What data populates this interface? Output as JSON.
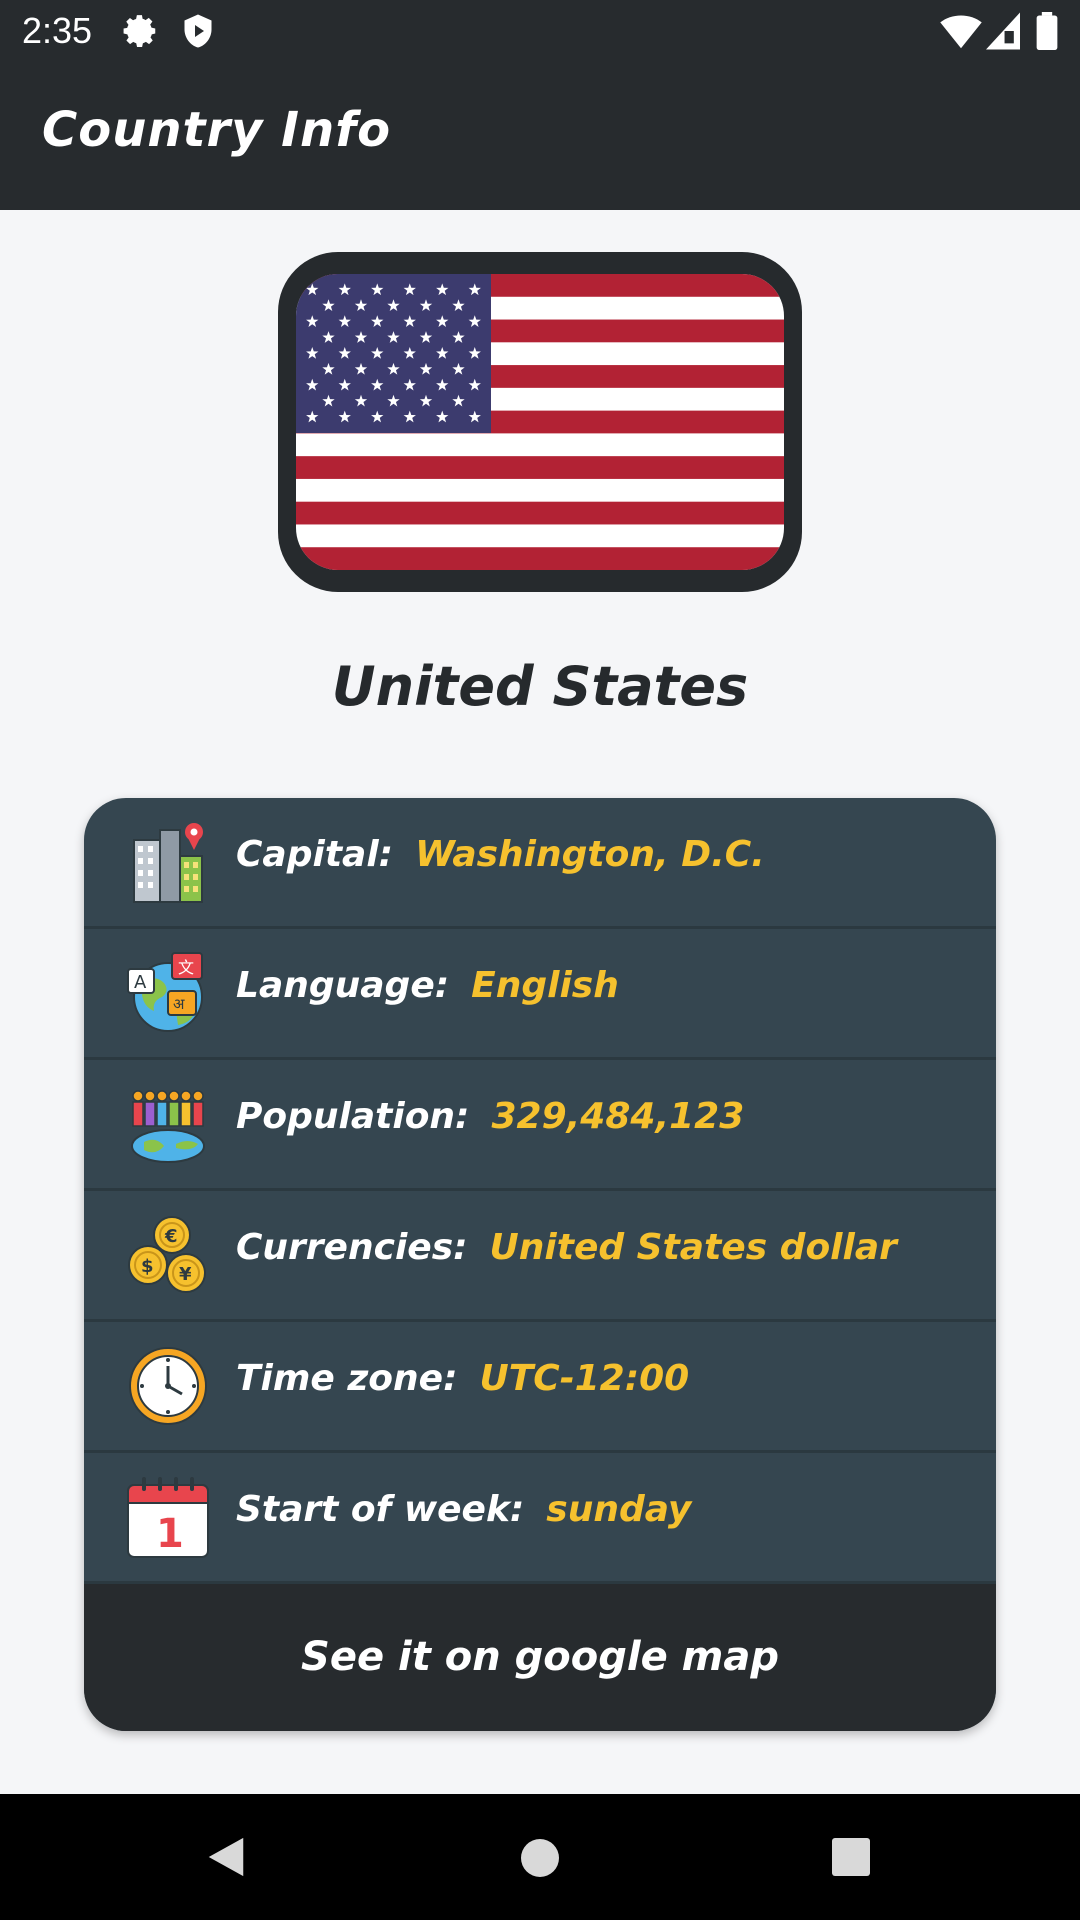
{
  "status_bar": {
    "time": "2:35",
    "icons": [
      "gear-icon",
      "shield-icon",
      "wifi-icon",
      "signal-icon",
      "battery-icon"
    ]
  },
  "app_bar": {
    "title": "Country Info"
  },
  "country": {
    "name": "United States",
    "flag": "us-flag"
  },
  "info": {
    "rows": [
      {
        "icon": "city-building-icon",
        "label": "Capital:",
        "value": "Washington, D.C."
      },
      {
        "icon": "language-globe-icon",
        "label": "Language:",
        "value": "English"
      },
      {
        "icon": "population-globe-icon",
        "label": "Population:",
        "value": "329,484,123"
      },
      {
        "icon": "currency-coins-icon",
        "label": "Currencies:",
        "value": "United States dollar"
      },
      {
        "icon": "clock-icon",
        "label": "Time zone:",
        "value": "UTC-12:00"
      },
      {
        "icon": "calendar-icon",
        "label": "Start of week:",
        "value": "sunday"
      }
    ],
    "map_button_label": "See it on google map"
  },
  "nav_bar": {
    "buttons": [
      "back-icon",
      "home-icon",
      "recents-icon"
    ]
  },
  "colors": {
    "app_bar": "#272b2e",
    "card": "#354650",
    "value_accent": "#f6c12e",
    "background": "#f5f6f8"
  }
}
